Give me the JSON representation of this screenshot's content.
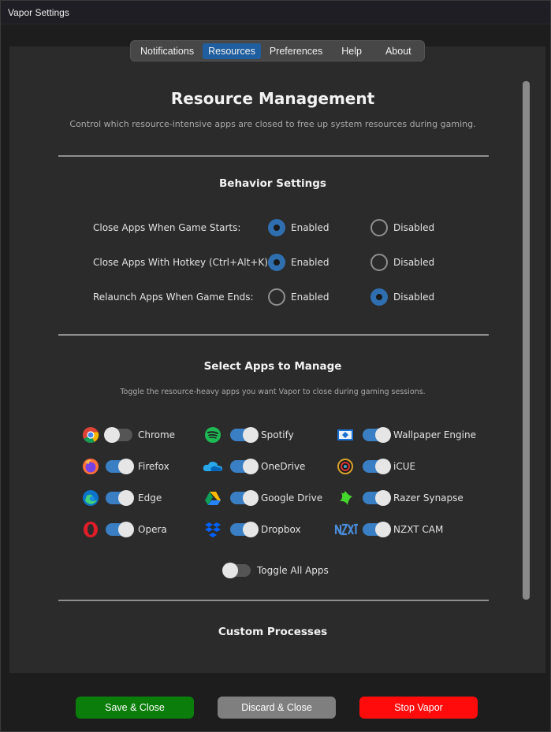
{
  "window": {
    "title": "Vapor Settings"
  },
  "tabs": [
    "Notifications",
    "Resources",
    "Preferences",
    "Help",
    "About"
  ],
  "active_tab": "Resources",
  "page": {
    "title": "Resource Management",
    "subtitle": "Control which resource-intensive apps are closed to free up system resources during gaming."
  },
  "behavior": {
    "title": "Behavior Settings",
    "enabled_label": "Enabled",
    "disabled_label": "Disabled",
    "rows": [
      {
        "label": "Close Apps When Game Starts:",
        "value": "Enabled"
      },
      {
        "label": "Close Apps With Hotkey (Ctrl+Alt+K):",
        "value": "Enabled"
      },
      {
        "label": "Relaunch Apps When Game Ends:",
        "value": "Disabled"
      }
    ]
  },
  "apps": {
    "title": "Select Apps to Manage",
    "subtitle": "Toggle the resource-heavy apps you want Vapor to close during gaming sessions.",
    "items": [
      {
        "name": "Chrome",
        "icon": "chrome-icon",
        "on": false
      },
      {
        "name": "Spotify",
        "icon": "spotify-icon",
        "on": true
      },
      {
        "name": "Wallpaper Engine",
        "icon": "wallpaper-engine-icon",
        "on": true
      },
      {
        "name": "Firefox",
        "icon": "firefox-icon",
        "on": true
      },
      {
        "name": "OneDrive",
        "icon": "onedrive-icon",
        "on": true
      },
      {
        "name": "iCUE",
        "icon": "icue-icon",
        "on": true
      },
      {
        "name": "Edge",
        "icon": "edge-icon",
        "on": true
      },
      {
        "name": "Google Drive",
        "icon": "google-drive-icon",
        "on": true
      },
      {
        "name": "Razer Synapse",
        "icon": "razer-icon",
        "on": true
      },
      {
        "name": "Opera",
        "icon": "opera-icon",
        "on": true
      },
      {
        "name": "Dropbox",
        "icon": "dropbox-icon",
        "on": true
      },
      {
        "name": "NZXT CAM",
        "icon": "nzxt-icon",
        "on": true
      }
    ],
    "toggle_all_label": "Toggle All Apps",
    "toggle_all_on": false
  },
  "custom": {
    "title": "Custom Processes"
  },
  "buttons": {
    "save": "Save & Close",
    "discard": "Discard & Close",
    "stop": "Stop Vapor"
  },
  "colors": {
    "accent": "#1f5fa0",
    "save": "#0a7d0a",
    "discard": "#7f7f7f",
    "stop": "#ff0b0b"
  }
}
